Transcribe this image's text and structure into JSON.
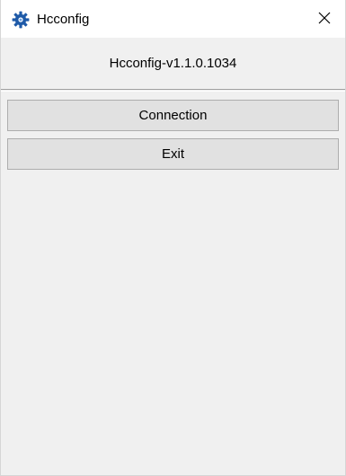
{
  "window": {
    "title": "Hcconfig",
    "app_icon": "gear-icon",
    "close_icon": "close-icon"
  },
  "header": {
    "version": "Hcconfig-v1.1.0.1034"
  },
  "buttons": {
    "connection_label": "Connection",
    "exit_label": "Exit"
  },
  "colors": {
    "icon_blue": "#1e5aa8",
    "button_face": "#e1e1e1",
    "button_border": "#adadad",
    "window_bg": "#f0f0f0"
  }
}
